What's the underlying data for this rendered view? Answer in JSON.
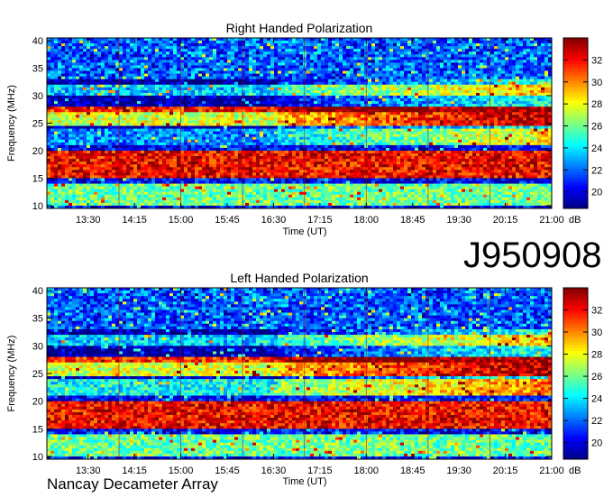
{
  "dataset_id": "J950908",
  "instrument": "Nancay Decameter Array",
  "colorbar": {
    "unit": "dB",
    "ticks": [
      20,
      22,
      24,
      26,
      28,
      30,
      32
    ],
    "range": [
      18.5,
      34
    ],
    "colormap": "jet"
  },
  "chart_data": [
    {
      "type": "heatmap",
      "title": "Right Handed Polarization",
      "xlabel": "Time (UT)",
      "ylabel": "Frequency (MHz)",
      "x_ticks": [
        "13:30",
        "14:15",
        "15:00",
        "15:45",
        "16:30",
        "17:15",
        "18:00",
        "18:45",
        "19:30",
        "20:15",
        "21:00"
      ],
      "y_ticks": [
        10,
        15,
        20,
        25,
        30,
        35,
        40
      ],
      "ylim": [
        9.5,
        40.5
      ],
      "xlim": [
        "12:50",
        "21:00"
      ],
      "intensity_unit": "dB",
      "emission_bands": [
        {
          "freq_mhz": [
            10,
            14
          ],
          "intensity_db": 26
        },
        {
          "freq_mhz": [
            15,
            20
          ],
          "intensity_db": 32
        },
        {
          "freq_mhz": [
            21,
            24
          ],
          "intensity_db": 24
        },
        {
          "freq_mhz": [
            24.5,
            27
          ],
          "intensity_db": 29
        },
        {
          "freq_mhz": [
            27,
            28
          ],
          "intensity_db": 33
        },
        {
          "freq_mhz": [
            30,
            32
          ],
          "intensity_db": 25
        }
      ]
    },
    {
      "type": "heatmap",
      "title": "Left Handed Polarization",
      "xlabel": "Time (UT)",
      "ylabel": "Frequency (MHz)",
      "x_ticks": [
        "13:30",
        "14:15",
        "15:00",
        "15:45",
        "16:30",
        "17:15",
        "18:00",
        "18:45",
        "19:30",
        "20:15",
        "21:00"
      ],
      "y_ticks": [
        10,
        15,
        20,
        25,
        30,
        35,
        40
      ],
      "ylim": [
        9.5,
        40.5
      ],
      "xlim": [
        "12:50",
        "21:00"
      ],
      "intensity_unit": "dB",
      "emission_bands": [
        {
          "freq_mhz": [
            10,
            14
          ],
          "intensity_db": 26
        },
        {
          "freq_mhz": [
            15,
            20
          ],
          "intensity_db": 32
        },
        {
          "freq_mhz": [
            21,
            24
          ],
          "intensity_db": 26
        },
        {
          "freq_mhz": [
            24.5,
            27
          ],
          "intensity_db": 29
        },
        {
          "freq_mhz": [
            27,
            28
          ],
          "intensity_db": 33
        },
        {
          "freq_mhz": [
            30,
            32
          ],
          "intensity_db": 25
        }
      ]
    }
  ]
}
